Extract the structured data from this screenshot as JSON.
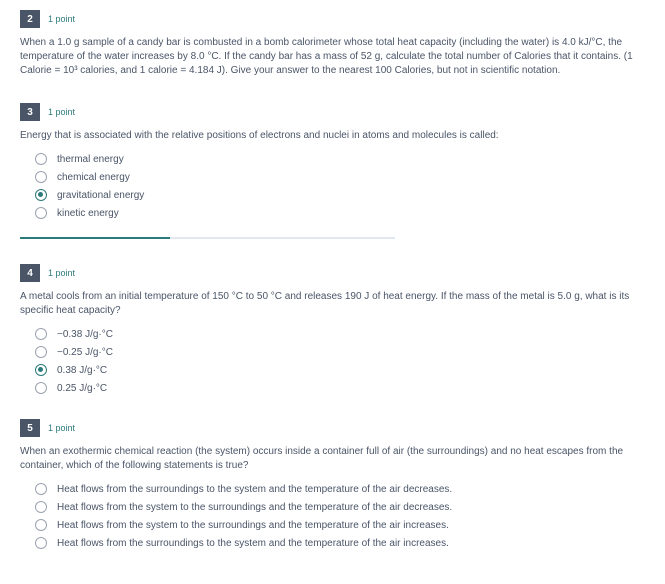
{
  "questions": [
    {
      "num": "2",
      "points": "1 point",
      "text": "When a 1.0 g sample of a candy bar is combusted in a bomb calorimeter whose total heat capacity (including the water) is 4.0 kJ/°C, the temperature of the water increases by 8.0 °C. If the candy bar has a mass of 52 g, calculate the total number of Calories that it contains. (1 Calorie = 10³ calories, and 1 calorie = 4.184 J). Give your answer to the nearest 100 Calories, but not in scientific notation.",
      "options": [],
      "selected": null,
      "progress": false
    },
    {
      "num": "3",
      "points": "1 point",
      "text": "Energy that is associated with the relative positions of electrons and nuclei in atoms and molecules is called:",
      "options": [
        "thermal energy",
        "chemical energy",
        "gravitational energy",
        "kinetic energy"
      ],
      "selected": 2,
      "progress": true
    },
    {
      "num": "4",
      "points": "1 point",
      "text": "A metal cools from an initial temperature of 150 °C to 50 °C and releases 190 J of heat energy. If the mass of the metal is 5.0 g, what is its specific heat capacity?",
      "options": [
        "−0.38 J/g·°C",
        "−0.25 J/g·°C",
        "0.38 J/g·°C",
        "0.25 J/g·°C"
      ],
      "selected": 2,
      "progress": false
    },
    {
      "num": "5",
      "points": "1 point",
      "text": "When an exothermic chemical reaction (the system) occurs inside a container full of air (the surroundings) and no heat escapes from the container, which of the following statements is true?",
      "options": [
        "Heat flows from the surroundings to the system and the temperature of the air decreases.",
        "Heat flows from the system to the surroundings and the temperature of the air decreases.",
        "Heat flows from the system to the surroundings and the temperature of the air increases.",
        "Heat flows from the surroundings to the system and the temperature of the air increases."
      ],
      "selected": null,
      "progress": false
    }
  ]
}
